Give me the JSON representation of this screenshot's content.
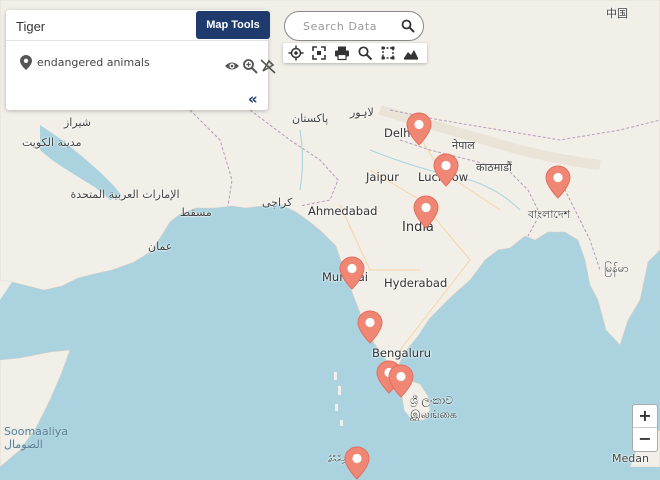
{
  "panel": {
    "species_value": "Tiger",
    "map_tools_label": "Map Tools",
    "layer_name": "endangered animals",
    "collapse_glyph": "«"
  },
  "search": {
    "placeholder": "Search Data"
  },
  "zoom": {
    "in_label": "+",
    "out_label": "−"
  },
  "colors": {
    "accent": "#1f3b6e",
    "marker": "#f08674",
    "water": "#aad3df",
    "land": "#f2efe9"
  },
  "toolbar_icons": [
    "locate-icon",
    "fullscreen-icon",
    "print-icon",
    "zoom-search-icon",
    "measure-icon",
    "basemap-icon"
  ],
  "map_labels": {
    "china": "中国",
    "delhi": "Delhi",
    "lucknow": "Lucknow",
    "jaipur": "Jaipur",
    "ahmedabad": "Ahmedabad",
    "india": "India",
    "mumbai": "Mumbai",
    "hyderabad": "Hyderabad",
    "bengaluru": "Bengaluru",
    "pakistan": "پاکستان",
    "lahore": "لاہور",
    "karachi": "کراچی",
    "shiraz": "شیراز",
    "kuwait": "مدينة الكويت",
    "uae": "الإمارات العربية المتحدة",
    "muscat": "مسقط",
    "oman": "عمان",
    "nepal": "नेपाल",
    "kathmandu": "काठमाडौं",
    "bangladesh": "বাংলাদেশ",
    "myanmar": "မြန်မာ",
    "srilanka": "ශ්‍රී ලංකාව இலங்கை",
    "somalia": "Soomaaliya الصومال",
    "maldives": "ދިވެހިރާއްޖެ",
    "medan": "Medan"
  },
  "markers_count": 10
}
